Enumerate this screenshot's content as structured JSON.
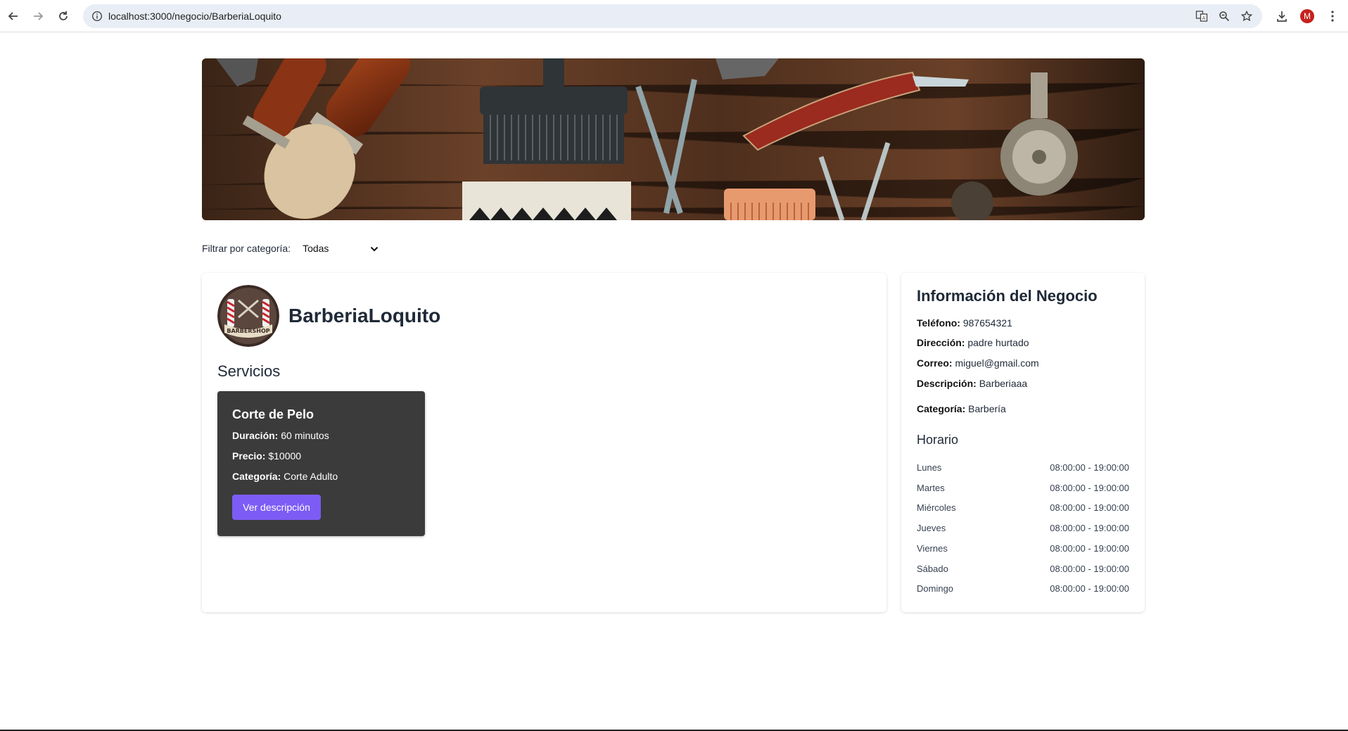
{
  "browser": {
    "url": "localhost:3000/negocio/BarberiaLoquito",
    "profile_initial": "M",
    "icons": [
      "back-icon",
      "forward-icon",
      "reload-icon",
      "site-info-icon",
      "translate-icon",
      "zoom-icon",
      "bookmark-star-icon",
      "download-icon",
      "menu-dots-icon"
    ]
  },
  "banner": {
    "description_icon": "barber-tools-banner"
  },
  "filter": {
    "label": "Filtrar por categoría:",
    "selected": "Todas"
  },
  "business": {
    "name": "BarberiaLoquito",
    "logo_text": "BARBERSHOP"
  },
  "services": {
    "title": "Servicios",
    "items": [
      {
        "name": "Corte de Pelo",
        "duration_label": "Duración:",
        "duration": "60 minutos",
        "price_label": "Precio:",
        "price": "$10000",
        "category_label": "Categoría:",
        "category": "Corte Adulto",
        "button": "Ver descripción"
      }
    ]
  },
  "info": {
    "title": "Información del Negocio",
    "phone_label": "Teléfono:",
    "phone": "987654321",
    "address_label": "Dirección:",
    "address": "padre hurtado",
    "email_label": "Correo:",
    "email": "miguel@gmail.com",
    "description_label": "Descripción:",
    "description": "Barberiaaa",
    "category_label": "Categoría:",
    "category": "Barbería"
  },
  "schedule": {
    "title": "Horario",
    "days": [
      {
        "day": "Lunes",
        "hours": "08:00:00 - 19:00:00"
      },
      {
        "day": "Martes",
        "hours": "08:00:00 - 19:00:00"
      },
      {
        "day": "Miércoles",
        "hours": "08:00:00 - 19:00:00"
      },
      {
        "day": "Jueves",
        "hours": "08:00:00 - 19:00:00"
      },
      {
        "day": "Viernes",
        "hours": "08:00:00 - 19:00:00"
      },
      {
        "day": "Sábado",
        "hours": "08:00:00 - 19:00:00"
      },
      {
        "day": "Domingo",
        "hours": "08:00:00 - 19:00:00"
      }
    ]
  },
  "colors": {
    "accent": "#7c5cf5",
    "service_card_bg": "#3b3b3b",
    "avatar": "#c5221f"
  }
}
